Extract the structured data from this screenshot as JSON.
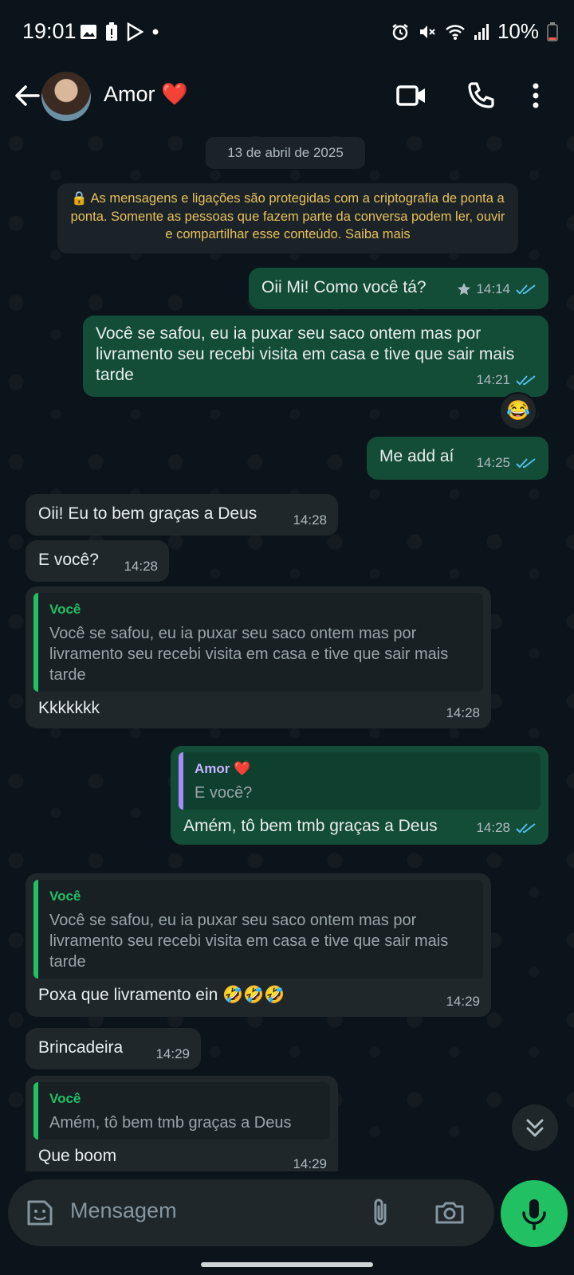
{
  "status_bar": {
    "time": "19:01",
    "battery": "10%"
  },
  "header": {
    "contact_name": "Amor",
    "contact_emoji": "❤️"
  },
  "chat": {
    "date_label": "13 de abril de 2025",
    "encryption_notice": "🔒 As mensagens e ligações são protegidas com a criptografia de ponta a ponta. Somente as pessoas que fazem parte da conversa podem ler, ouvir e compartilhar esse conteúdo. Saiba mais",
    "messages": [
      {
        "text": "Oii Mi! Como você tá?",
        "time": "14:14"
      },
      {
        "text": "Você se safou, eu ia puxar seu saco ontem mas por livramento seu recebi visita em casa e tive que sair mais tarde",
        "time": "14:21",
        "reaction": "😂"
      },
      {
        "text": "Me add aí",
        "time": "14:25"
      },
      {
        "text": "Oii! Eu to bem graças a Deus",
        "time": "14:28"
      },
      {
        "text": "E você?",
        "time": "14:28"
      },
      {
        "quote_author": "Você",
        "quote_text": "Você se safou, eu ia puxar seu saco ontem mas por livramento seu recebi visita em casa e tive que sair mais tarde",
        "text": "Kkkkkkk",
        "time": "14:28"
      },
      {
        "quote_author": "Amor ❤️",
        "quote_text": "E você?",
        "text": "Amém, tô bem tmb graças a Deus",
        "time": "14:28"
      },
      {
        "quote_author": "Você",
        "quote_text": "Você se safou, eu ia puxar seu saco ontem mas por livramento seu recebi visita em casa e tive que sair mais tarde",
        "text": "Poxa que livramento ein 🤣🤣🤣",
        "time": "14:29"
      },
      {
        "text": "Brincadeira",
        "time": "14:29"
      },
      {
        "quote_author": "Você",
        "quote_text": "Amém, tô bem tmb graças a Deus",
        "text": "Que boom",
        "time": "14:29"
      }
    ]
  },
  "input": {
    "placeholder": "Mensagem"
  },
  "colors": {
    "outgoing_bubble": "#134d37",
    "incoming_bubble": "#1f272a",
    "accent": "#21c063",
    "notice_text": "#e6c05b",
    "read_ticks": "#53bdeb"
  }
}
